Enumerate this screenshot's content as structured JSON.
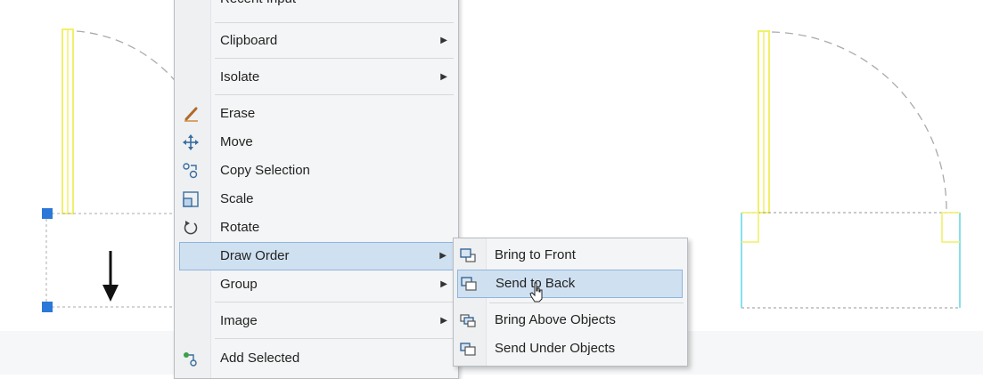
{
  "drawing": {
    "objects": [
      "door-left",
      "door-right"
    ]
  },
  "context_menu": {
    "items": [
      {
        "label": "Recent Input",
        "icon": "none"
      },
      {
        "label": "Clipboard",
        "submenu": true,
        "icon": "none"
      },
      {
        "label": "Isolate",
        "submenu": true,
        "icon": "none"
      },
      {
        "label": "Erase",
        "icon": "erase-icon"
      },
      {
        "label": "Move",
        "icon": "move-icon"
      },
      {
        "label": "Copy Selection",
        "icon": "copy-selection-icon"
      },
      {
        "label": "Scale",
        "icon": "scale-icon"
      },
      {
        "label": "Rotate",
        "icon": "rotate-icon"
      },
      {
        "label": "Draw Order",
        "submenu": true,
        "highlighted": true,
        "icon": "none"
      },
      {
        "label": "Group",
        "submenu": true,
        "icon": "none"
      },
      {
        "label": "Image",
        "submenu": true,
        "icon": "none"
      },
      {
        "label": "Add Selected",
        "icon": "add-selected-icon"
      }
    ]
  },
  "draw_order_submenu": {
    "items": [
      {
        "label": "Bring to Front",
        "icon": "bring-to-front-icon"
      },
      {
        "label": "Send to Back",
        "icon": "send-to-back-icon",
        "highlighted": true
      },
      {
        "label": "Bring Above Objects",
        "icon": "bring-above-objects-icon"
      },
      {
        "label": "Send Under Objects",
        "icon": "send-under-objects-icon"
      }
    ]
  },
  "colors": {
    "menu_bg": "#f4f5f6",
    "highlight": "#cfe0f1",
    "highlight_border": "#8eb5dc",
    "door_yellow": "#f2f06a",
    "grip_blue": "#2b78d8",
    "cyan_frame": "#5fd6e6"
  },
  "symbols": {
    "submenu_arrow": "▶"
  }
}
